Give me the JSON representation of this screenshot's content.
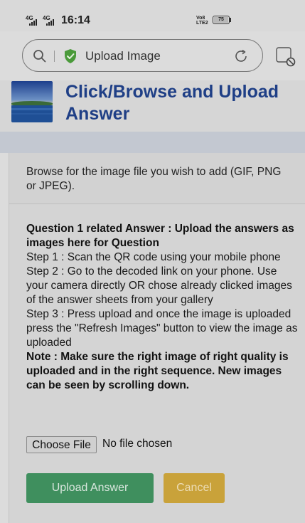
{
  "status_bar": {
    "signal1": "4G",
    "signal2": "4G",
    "time": "16:14",
    "volte": "Vo8 LTE2",
    "battery": "75"
  },
  "browser": {
    "url_text": "Upload Image",
    "icons": [
      "search-icon",
      "shield-icon",
      "reload-icon",
      "ad-block-icon"
    ]
  },
  "header": {
    "title": "Click/Browse and Upload Answer"
  },
  "description": "Browse for the image file you wish to add (GIF, PNG or JPEG).",
  "instructions": {
    "heading": "Question 1 related Answer : Upload the answers as images here for Question",
    "step1": "Step 1 : Scan the QR code using your mobile phone",
    "step2": "Step 2 : Go to the decoded link on your phone. Use your camera directly OR chose already clicked images of the answer sheets from your gallery",
    "step3": "Step 3 : Press upload and once the image is uploaded press the \"Refresh Images\" button to view the image as uploaded",
    "note": "Note : Make sure the right image of right quality is uploaded and in the right sequence. New images can be seen by scrolling down."
  },
  "file_input": {
    "button_label": "Choose File",
    "status": "No file chosen"
  },
  "actions": {
    "upload_label": "Upload Answer",
    "cancel_label": "Cancel"
  },
  "colors": {
    "title": "#1f3f86",
    "upload_button": "#3f8f5e",
    "cancel_button": "#c9a23a",
    "shield": "#4a9a3a"
  }
}
